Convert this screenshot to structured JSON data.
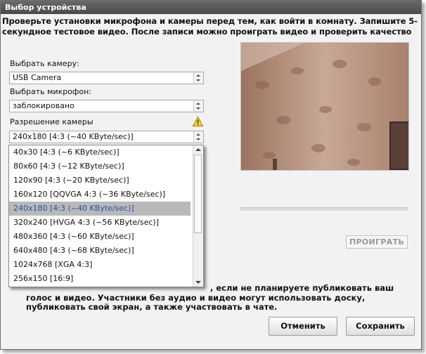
{
  "window": {
    "title": "Выбор устройства"
  },
  "intro_text": "Проверьте установки микрофона и камеры перед тем, как войти в комнату. Запишите 5-секундное тестовое видео. После записи можно проиграть видео и проверить качество",
  "camera": {
    "label": "Выбрать камеру:",
    "value": "USB Camera"
  },
  "microphone": {
    "label": "Выбрать микрофон:",
    "value": "заблокировано"
  },
  "resolution": {
    "label": "Разрешение камеры",
    "value": "240x180 [4:3 (~40 KByte/sec)]",
    "warning_icon": "warning-triangle-icon",
    "options": [
      "40x30 [4:3 (~6 KByte/sec)]",
      "80x60 [4:3 (~12 KByte/sec)]",
      "120x90 [4:3 (~20 KByte/sec)]",
      "160x120 [QQVGA 4:3 (~36 KByte/sec)]",
      "240x180 [4:3 (~40 KByte/sec)]",
      "320x240 [HVGA 4:3 (~56 KByte/sec)]",
      "480x360 [4:3  (~60 KByte/sec)]",
      "640x480 [4:3 (~68 KByte/sec)]",
      "1024x768 [XGA 4:3]",
      "256x150 [16:9]"
    ],
    "selected_index": 4
  },
  "play_label": "ПРОИГРАТЬ",
  "note": {
    "line1": ", если не планируете публиковать ваш",
    "rest": "голос и видео. Участники без аудио и видео могут использовать доску, публиковать свой экран, а также участвовать в чате."
  },
  "buttons": {
    "cancel": "Отменить",
    "save": "Сохранить"
  },
  "colors": {
    "titlebar": "#4a4a4a",
    "selected_item": "#b9b9b9",
    "selected_text": "#2a4fb0"
  }
}
